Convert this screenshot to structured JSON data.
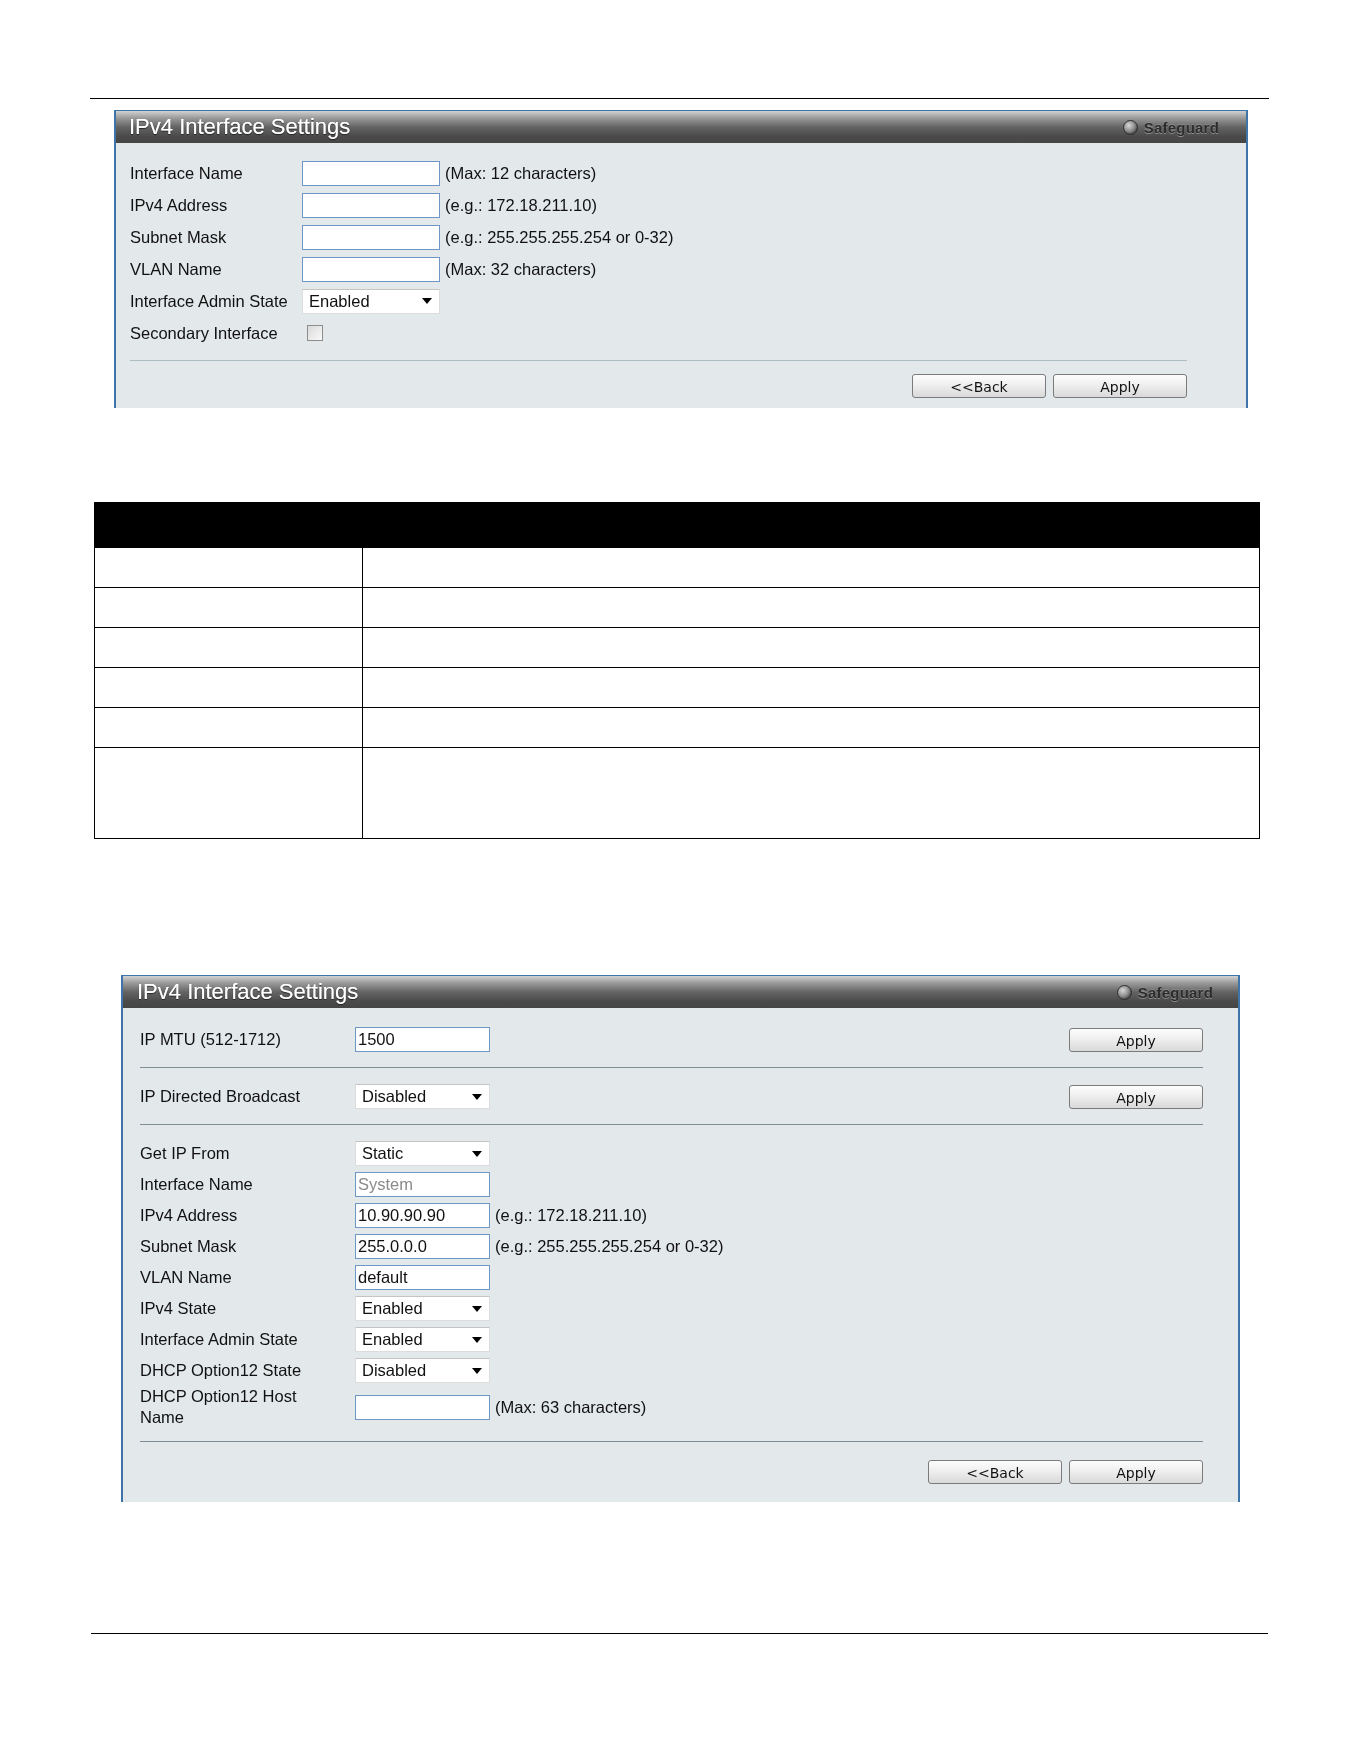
{
  "panels": [
    {
      "title": "IPv4 Interface Settings",
      "badge": "Safeguard",
      "sections": [
        {
          "rows": [
            {
              "kind": "text",
              "label": "Interface Name",
              "hint": "(Max: 12 characters)"
            },
            {
              "kind": "text",
              "label": "IPv4 Address",
              "hint": "(e.g.: 172.18.211.10)"
            },
            {
              "kind": "text",
              "label": "Subnet Mask",
              "hint": "(e.g.: 255.255.255.254 or 0-32)"
            },
            {
              "kind": "text",
              "label": "VLAN Name",
              "hint": "(Max: 32 characters)"
            },
            {
              "kind": "select",
              "label": "Interface Admin State",
              "value": "Enabled"
            },
            {
              "kind": "checkbox",
              "label": "Secondary Interface",
              "checked": false
            }
          ]
        }
      ],
      "buttons": [
        "<<Back",
        "Apply"
      ]
    },
    {
      "title": "IPv4 Interface Settings",
      "badge": "Safeguard",
      "sections": [
        {
          "rows": [
            {
              "kind": "text",
              "label": "IP MTU (512-1712)",
              "value": "1500",
              "disabled": false
            }
          ],
          "action": "Apply"
        },
        {
          "rows": [
            {
              "kind": "select",
              "label": "IP Directed Broadcast",
              "value": "Disabled"
            }
          ],
          "action": "Apply"
        },
        {
          "rows": [
            {
              "kind": "select",
              "label": "Get IP From",
              "value": "Static"
            },
            {
              "kind": "text",
              "label": "Interface Name",
              "value": "System",
              "disabled": true
            },
            {
              "kind": "text",
              "label": "IPv4 Address",
              "value": "10.90.90.90",
              "disabled": false,
              "hint": "(e.g.: 172.18.211.10)"
            },
            {
              "kind": "text",
              "label": "Subnet Mask",
              "value": "255.0.0.0",
              "disabled": false,
              "hint": "(e.g.: 255.255.255.254 or 0-32)"
            },
            {
              "kind": "text",
              "label": "VLAN Name",
              "value": "default",
              "disabled": false
            },
            {
              "kind": "select",
              "label": "IPv4 State",
              "value": "Enabled"
            },
            {
              "kind": "select",
              "label": "Interface Admin State",
              "value": "Enabled"
            },
            {
              "kind": "select",
              "label": "DHCP Option12 State",
              "value": "Disabled"
            },
            {
              "kind": "text",
              "label": "DHCP Option12 Host Name",
              "hint": "(Max: 63 characters)"
            }
          ]
        }
      ],
      "buttons": [
        "<<Back",
        "Apply"
      ]
    }
  ]
}
